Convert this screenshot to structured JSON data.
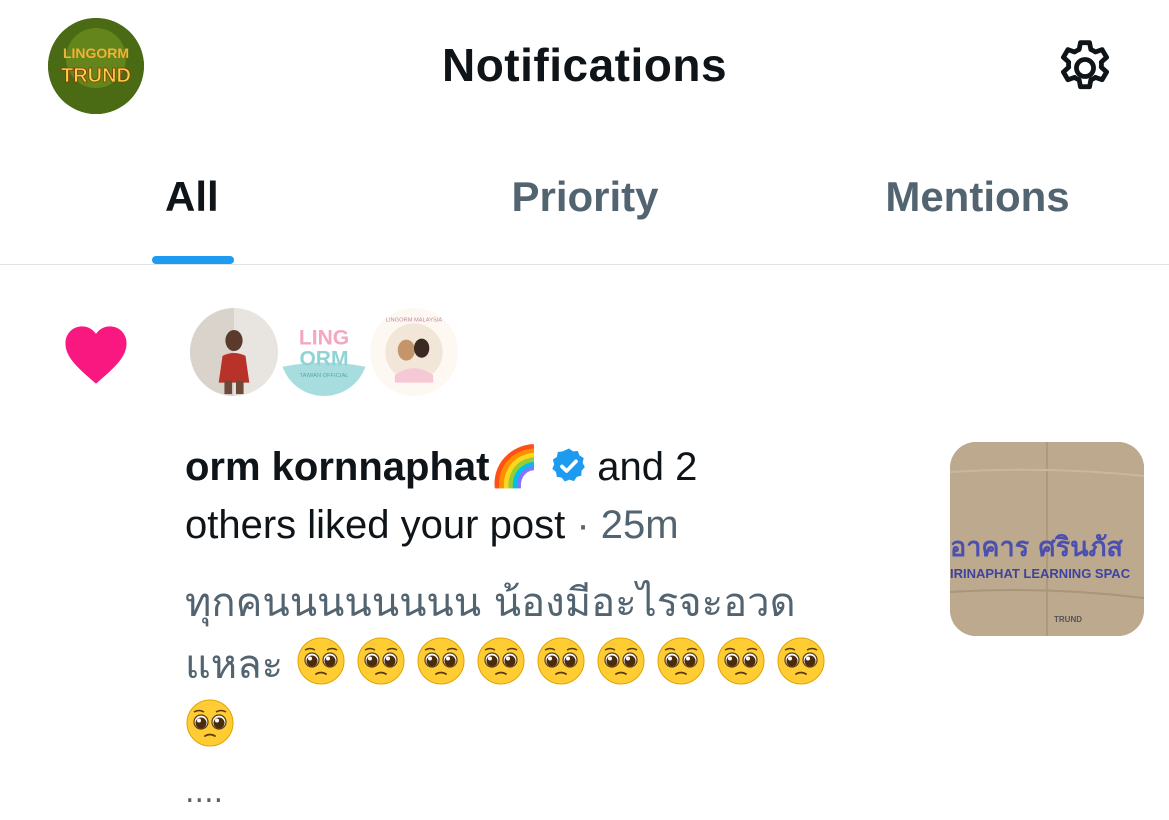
{
  "header": {
    "title": "Notifications",
    "avatar_text_top": "LINGORM",
    "avatar_text_bottom": "TRUND",
    "settings_icon": "gear-icon"
  },
  "tabs": [
    {
      "label": "All",
      "active": true
    },
    {
      "label": "Priority",
      "active": false
    },
    {
      "label": "Mentions",
      "active": false
    }
  ],
  "notification": {
    "icon": "heart-icon",
    "icon_color": "#f91880",
    "avatar_labels": {
      "second_top": "LING",
      "second_bottom": "ORM",
      "second_caption": "TAIWAN OFFICIAL",
      "third_caption_top": "LINGORM MALAYSIA"
    },
    "actor_name": "orm kornnaphat🌈",
    "verified": true,
    "summary_part1": "and 2",
    "summary_part2": "others liked your post",
    "separator": "·",
    "time": "25m",
    "post_text_line1": "ทุกคนนนนนนนน น้องมีอะไรจะอวด",
    "post_text_line2": "แหละ",
    "emoji_count": 10,
    "ellipsis": "....",
    "thumbnail": {
      "sign_thai": "อาคาร ศรินภัส",
      "sign_english": "IRINAPHAT LEARNING SPAC",
      "watermark": "TRUND"
    }
  },
  "colors": {
    "accent": "#1d9bf0",
    "text_primary": "#0f1419",
    "text_secondary": "#536471",
    "heart": "#f91880"
  }
}
